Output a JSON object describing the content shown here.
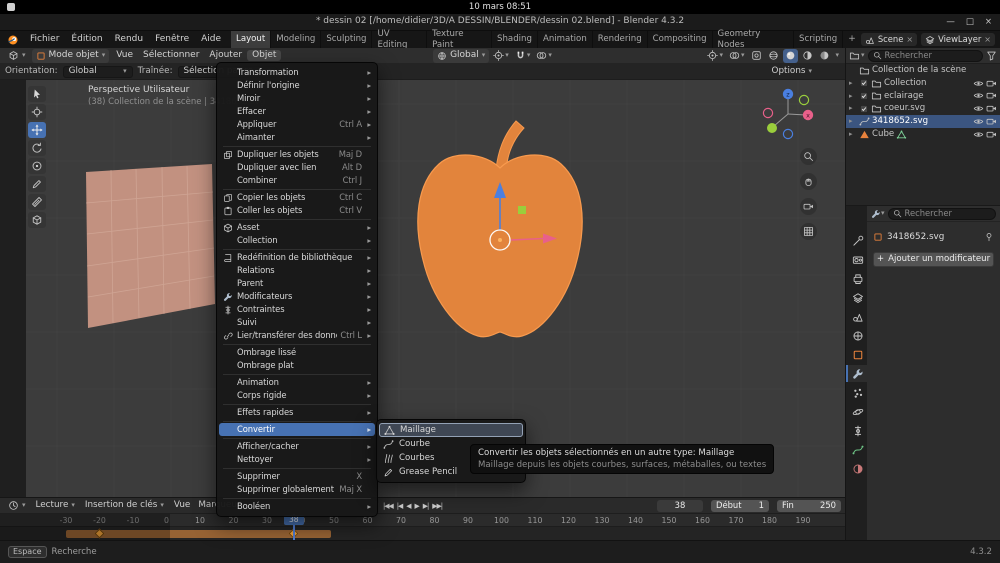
{
  "system_bar": {
    "clock": "10 mars 08:51"
  },
  "title_bar": {
    "title": "* dessin 02 [/home/didier/3D/A DESSIN/BLENDER/dessin 02.blend] - Blender 4.3.2"
  },
  "topbar": {
    "menus": [
      "Fichier",
      "Édition",
      "Rendu",
      "Fenêtre",
      "Aide"
    ],
    "workspaces": [
      "Layout",
      "Modeling",
      "Sculpting",
      "UV Editing",
      "Texture Paint",
      "Shading",
      "Animation",
      "Rendering",
      "Compositing",
      "Geometry Nodes",
      "Scripting"
    ],
    "active_workspace": "Layout",
    "add_tab": "+",
    "scene_name": "Scene",
    "view_layer_name": "ViewLayer"
  },
  "viewport": {
    "header": {
      "mode": "Mode objet",
      "menus": [
        "Vue",
        "Sélectionner",
        "Ajouter",
        "Objet"
      ],
      "open_menu": "Objet",
      "orientation": "Global"
    },
    "tool_settings": {
      "orientation_label": "Orientation:",
      "orientation_value": "Global",
      "drag_label": "Traînée:",
      "drag_value": "Sélection par re...",
      "options_label": "Options"
    },
    "overlay": {
      "view_name": "Perspective Utilisateur",
      "context": "(38) Collection de la scène | 3418652.svg"
    },
    "tools": [
      "select-box",
      "cursor",
      "move",
      "rotate",
      "transform",
      "annotate",
      "measure",
      "add-cube"
    ],
    "active_tool": "move",
    "axis_labels": {
      "x": "x",
      "y": "y",
      "z": "z"
    },
    "colors": {
      "apple": "#e2843c",
      "apple_outline": "#f89a4e",
      "plane": "#c29180",
      "axis_x": "#e8608a",
      "axis_y": "#9ace3c",
      "axis_z": "#4a7fe0"
    }
  },
  "object_menu": {
    "title": "Objet",
    "items": [
      {
        "label": "Transformation",
        "submenu": true
      },
      {
        "label": "Définir l'origine",
        "submenu": true
      },
      {
        "label": "Miroir",
        "submenu": true
      },
      {
        "label": "Effacer",
        "submenu": true
      },
      {
        "label": "Appliquer",
        "shortcut": "Ctrl A",
        "submenu": true
      },
      {
        "label": "Aimanter",
        "submenu": true
      },
      {
        "separator": true
      },
      {
        "label": "Dupliquer les objets",
        "shortcut": "Maj D",
        "icon": "duplicate"
      },
      {
        "label": "Dupliquer avec lien",
        "shortcut": "Alt D"
      },
      {
        "label": "Combiner",
        "shortcut": "Ctrl J"
      },
      {
        "separator": true
      },
      {
        "label": "Copier les objets",
        "shortcut": "Ctrl C",
        "icon": "copy"
      },
      {
        "label": "Coller les objets",
        "shortcut": "Ctrl V",
        "icon": "paste"
      },
      {
        "separator": true
      },
      {
        "label": "Asset",
        "submenu": true,
        "icon": "asset"
      },
      {
        "label": "Collection",
        "submenu": true
      },
      {
        "separator": true
      },
      {
        "label": "Redéfinition de bibliothèque",
        "submenu": true,
        "icon": "library"
      },
      {
        "label": "Relations",
        "submenu": true
      },
      {
        "label": "Parent",
        "submenu": true
      },
      {
        "label": "Modificateurs",
        "submenu": true,
        "icon": "wrench"
      },
      {
        "label": "Contraintes",
        "submenu": true,
        "icon": "constraint"
      },
      {
        "label": "Suivi",
        "submenu": true
      },
      {
        "label": "Lier/transférer des données",
        "shortcut": "Ctrl L",
        "submenu": true,
        "icon": "link"
      },
      {
        "separator": true
      },
      {
        "label": "Ombrage lissé"
      },
      {
        "label": "Ombrage plat"
      },
      {
        "separator": true
      },
      {
        "label": "Animation",
        "submenu": true
      },
      {
        "label": "Corps rigide",
        "submenu": true
      },
      {
        "separator": true
      },
      {
        "label": "Effets rapides",
        "submenu": true
      },
      {
        "separator": true
      },
      {
        "label": "Convertir",
        "submenu": true,
        "active": true
      },
      {
        "separator": true
      },
      {
        "label": "Afficher/cacher",
        "submenu": true
      },
      {
        "label": "Nettoyer",
        "submenu": true
      },
      {
        "separator": true
      },
      {
        "label": "Supprimer",
        "shortcut": "X"
      },
      {
        "label": "Supprimer globalement",
        "shortcut": "Maj X"
      },
      {
        "separator": true
      },
      {
        "label": "Booléen",
        "submenu": true
      }
    ]
  },
  "convert_submenu": {
    "items": [
      {
        "label": "Maillage",
        "icon": "mesh",
        "active": true
      },
      {
        "label": "Courbe",
        "icon": "curve"
      },
      {
        "label": "Courbes",
        "icon": "curves"
      },
      {
        "label": "Grease Pencil",
        "icon": "pencil"
      }
    ]
  },
  "tooltip": {
    "line1": "Convertir les objets sélectionnés en un autre type: Maillage",
    "line2": "Maillage depuis les objets courbes, surfaces, métaballes, ou textes"
  },
  "outliner": {
    "search_placeholder": "Rechercher",
    "rows": [
      {
        "label": "Collection de la scène",
        "kind": "scene"
      },
      {
        "label": "Collection",
        "kind": "collection"
      },
      {
        "label": "eclairage",
        "kind": "collection"
      },
      {
        "label": "coeur.svg",
        "kind": "collection"
      },
      {
        "label": "3418652.svg",
        "kind": "curve",
        "selected": true
      },
      {
        "label": "Cube",
        "kind": "mesh"
      }
    ]
  },
  "properties": {
    "search_placeholder": "Rechercher",
    "object_name": "3418652.svg",
    "add_modifier_label": "Ajouter un modificateur",
    "tabs": [
      "tool",
      "render",
      "output",
      "view-layer",
      "scene",
      "world",
      "object",
      "modifiers",
      "particles",
      "physics",
      "constraints",
      "object-data",
      "material"
    ],
    "active_tab": "modifiers"
  },
  "timeline": {
    "playback_label": "Lecture",
    "keying_label": "Insertion de clés",
    "menus": [
      "Vue",
      "Marqueur"
    ],
    "current_frame": "38",
    "start_label": "Début",
    "start_value": "1",
    "end_label": "Fin",
    "end_value": "250",
    "tick_start": -30,
    "tick_end": 190,
    "tick_step": 10,
    "playback_range_start": 1,
    "band_start": -30,
    "band_end": 49,
    "keyframes": [
      -20,
      38
    ]
  },
  "status_bar": {
    "shortcut_key": "Espace",
    "shortcut_action": "Recherche",
    "version": "4.3.2"
  }
}
